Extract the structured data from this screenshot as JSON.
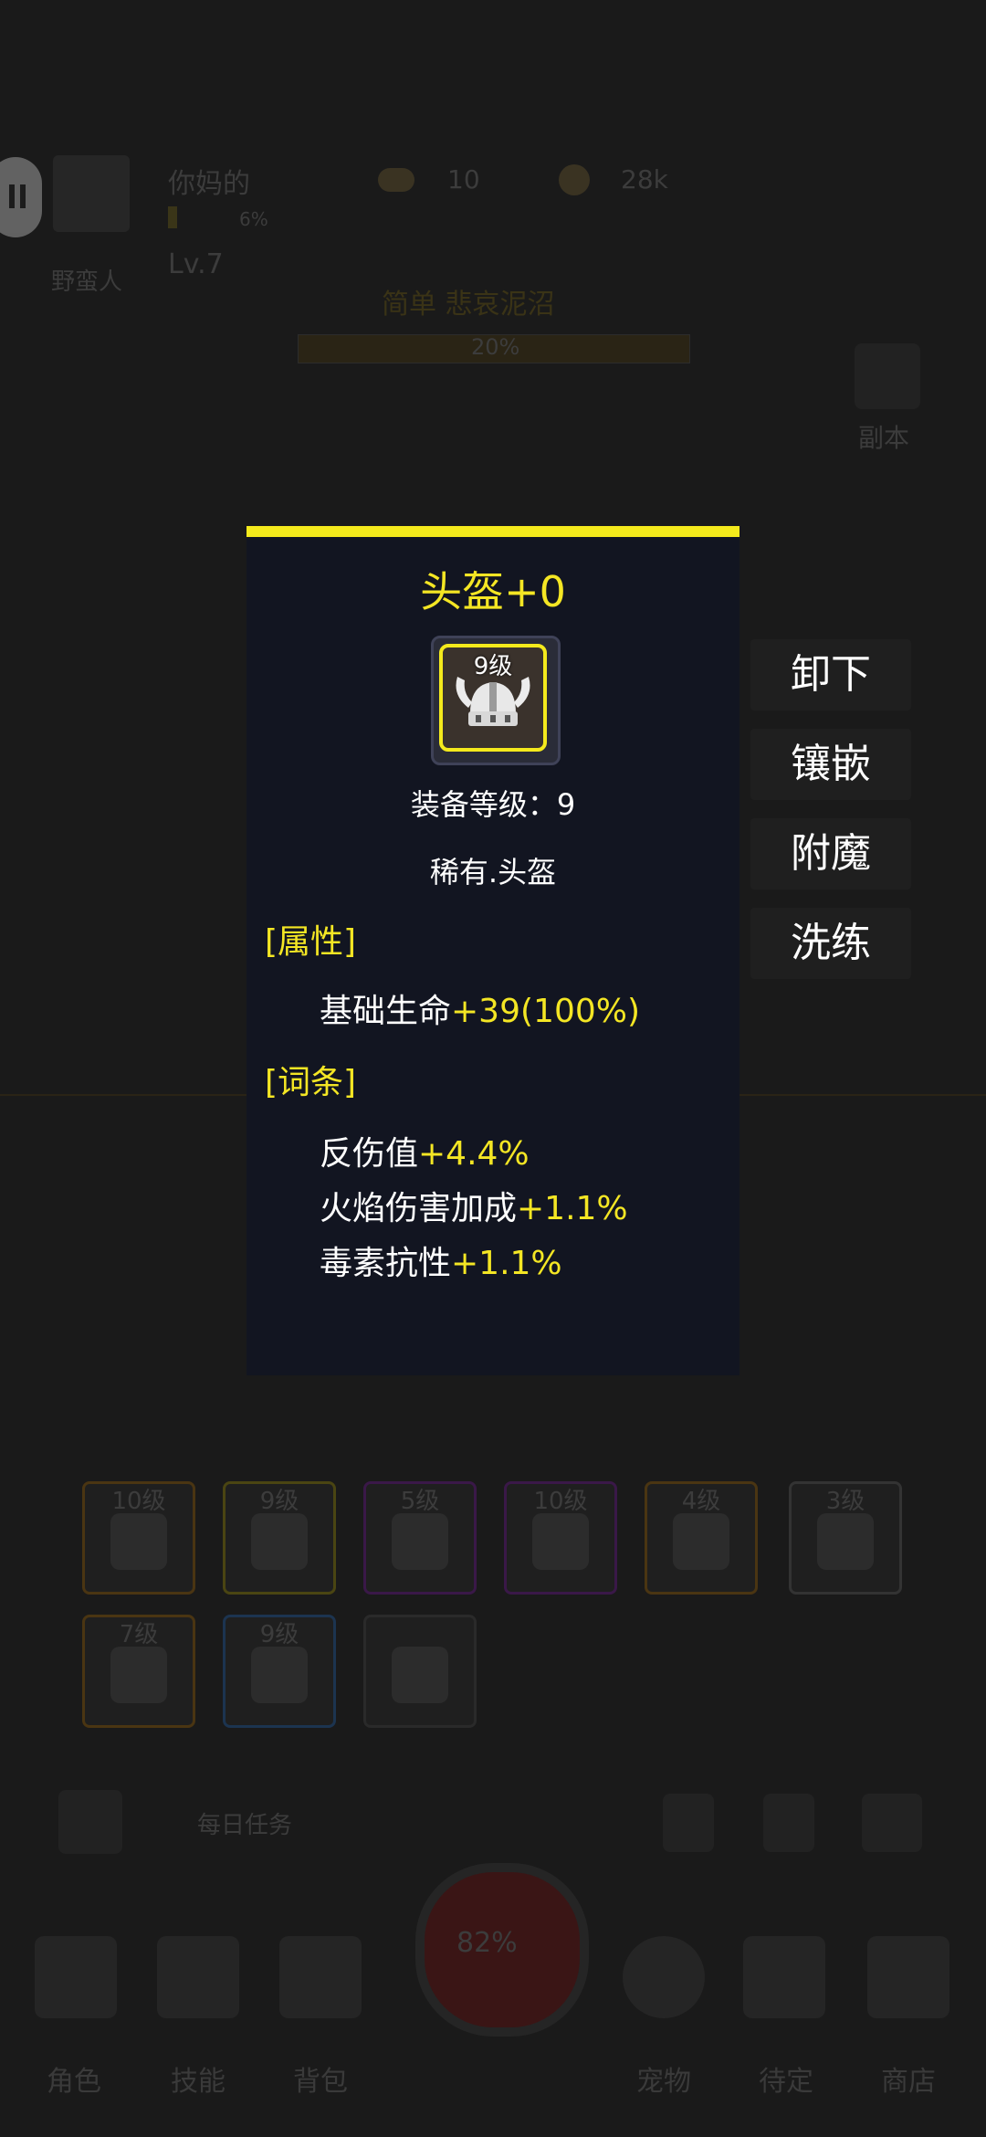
{
  "background": {
    "player_name": "你妈的",
    "player_class": "野蛮人",
    "player_level": "Lv.7",
    "exp_percent": "6%",
    "gold_count": "10",
    "coin_count": "28k",
    "stage_name": "简单 悲哀泥沼",
    "stage_progress": "20%",
    "dungeon_label": "副本",
    "daily_task_label": "每日任务",
    "orb_percent": "82%",
    "equip_slots": [
      {
        "level": "10级",
        "color": "#4a3512"
      },
      {
        "level": "9级",
        "color": "#4a4512"
      },
      {
        "level": "5级",
        "color": "#3a1848"
      },
      {
        "level": "10级",
        "color": "#3a1848"
      },
      {
        "level": "4级",
        "color": "#4a3512"
      },
      {
        "level": "3级",
        "color": "#333333"
      },
      {
        "level": "7级",
        "color": "#4a3512"
      },
      {
        "level": "9级",
        "color": "#1c3450"
      },
      {
        "level": "",
        "color": "#2a2a2a"
      }
    ],
    "nav": [
      "角色",
      "技能",
      "背包",
      "宠物",
      "待定",
      "商店"
    ]
  },
  "modal": {
    "title": "头盔+0",
    "item_level": "9级",
    "item_icon": "viking-helmet-icon",
    "equip_level_text": "装备等级：9",
    "rarity_text": "稀有.头盔",
    "attributes_header": "[属性]",
    "attributes": [
      {
        "name": "基础生命",
        "value": "+39(100%)"
      }
    ],
    "affixes_header": "[词条]",
    "affixes": [
      {
        "name": "反伤值",
        "value": "+4.4%"
      },
      {
        "name": "火焰伤害加成",
        "value": "+1.1%"
      },
      {
        "name": "毒素抗性",
        "value": "+1.1%"
      }
    ]
  },
  "actions": {
    "unequip": "卸下",
    "inlay": "镶嵌",
    "enchant": "附魔",
    "reforge": "洗练"
  },
  "colors": {
    "accent_yellow": "#f4e624",
    "modal_bg": "#121521"
  }
}
